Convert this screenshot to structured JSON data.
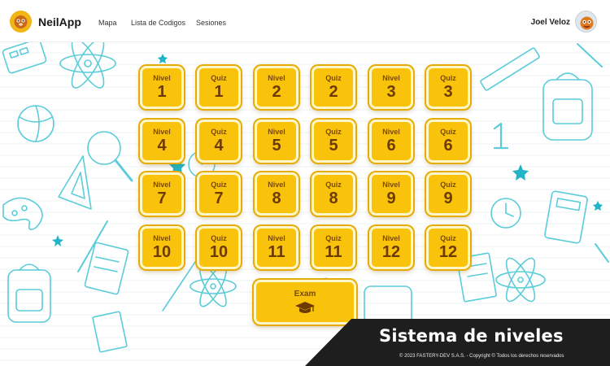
{
  "app": {
    "name": "NeilApp"
  },
  "nav": [
    {
      "label": "Mapa"
    },
    {
      "label": "Lista de Codigos"
    },
    {
      "label": "Sesiones"
    }
  ],
  "user": {
    "name": "Joel Veloz"
  },
  "tiles": [
    {
      "kind": "Nivel",
      "number": "1"
    },
    {
      "kind": "Quiz",
      "number": "1"
    },
    {
      "kind": "Nivel",
      "number": "2"
    },
    {
      "kind": "Quiz",
      "number": "2"
    },
    {
      "kind": "Nivel",
      "number": "3"
    },
    {
      "kind": "Quiz",
      "number": "3"
    },
    {
      "kind": "Nivel",
      "number": "4"
    },
    {
      "kind": "Quiz",
      "number": "4"
    },
    {
      "kind": "Nivel",
      "number": "5"
    },
    {
      "kind": "Quiz",
      "number": "5"
    },
    {
      "kind": "Nivel",
      "number": "6"
    },
    {
      "kind": "Quiz",
      "number": "6"
    },
    {
      "kind": "Nivel",
      "number": "7"
    },
    {
      "kind": "Quiz",
      "number": "7"
    },
    {
      "kind": "Nivel",
      "number": "8"
    },
    {
      "kind": "Quiz",
      "number": "8"
    },
    {
      "kind": "Nivel",
      "number": "9"
    },
    {
      "kind": "Quiz",
      "number": "9"
    },
    {
      "kind": "Nivel",
      "number": "10"
    },
    {
      "kind": "Quiz",
      "number": "10"
    },
    {
      "kind": "Nivel",
      "number": "11"
    },
    {
      "kind": "Quiz",
      "number": "11"
    },
    {
      "kind": "Nivel",
      "number": "12"
    },
    {
      "kind": "Quiz",
      "number": "12"
    }
  ],
  "exam": {
    "label": "Exam",
    "icon": "graduation-cap-icon"
  },
  "banner": {
    "title": "Sistema de niveles",
    "copyright": "© 2023 FASTERY-DEV S.A.S. - Copyright © Todos los derechos reservados"
  },
  "colors": {
    "tile": "#f9c30c",
    "tile_border": "#e6ac05",
    "tile_text": "#6d3a00",
    "pattern": "#22b5c7",
    "banner": "#1e1e1e"
  }
}
